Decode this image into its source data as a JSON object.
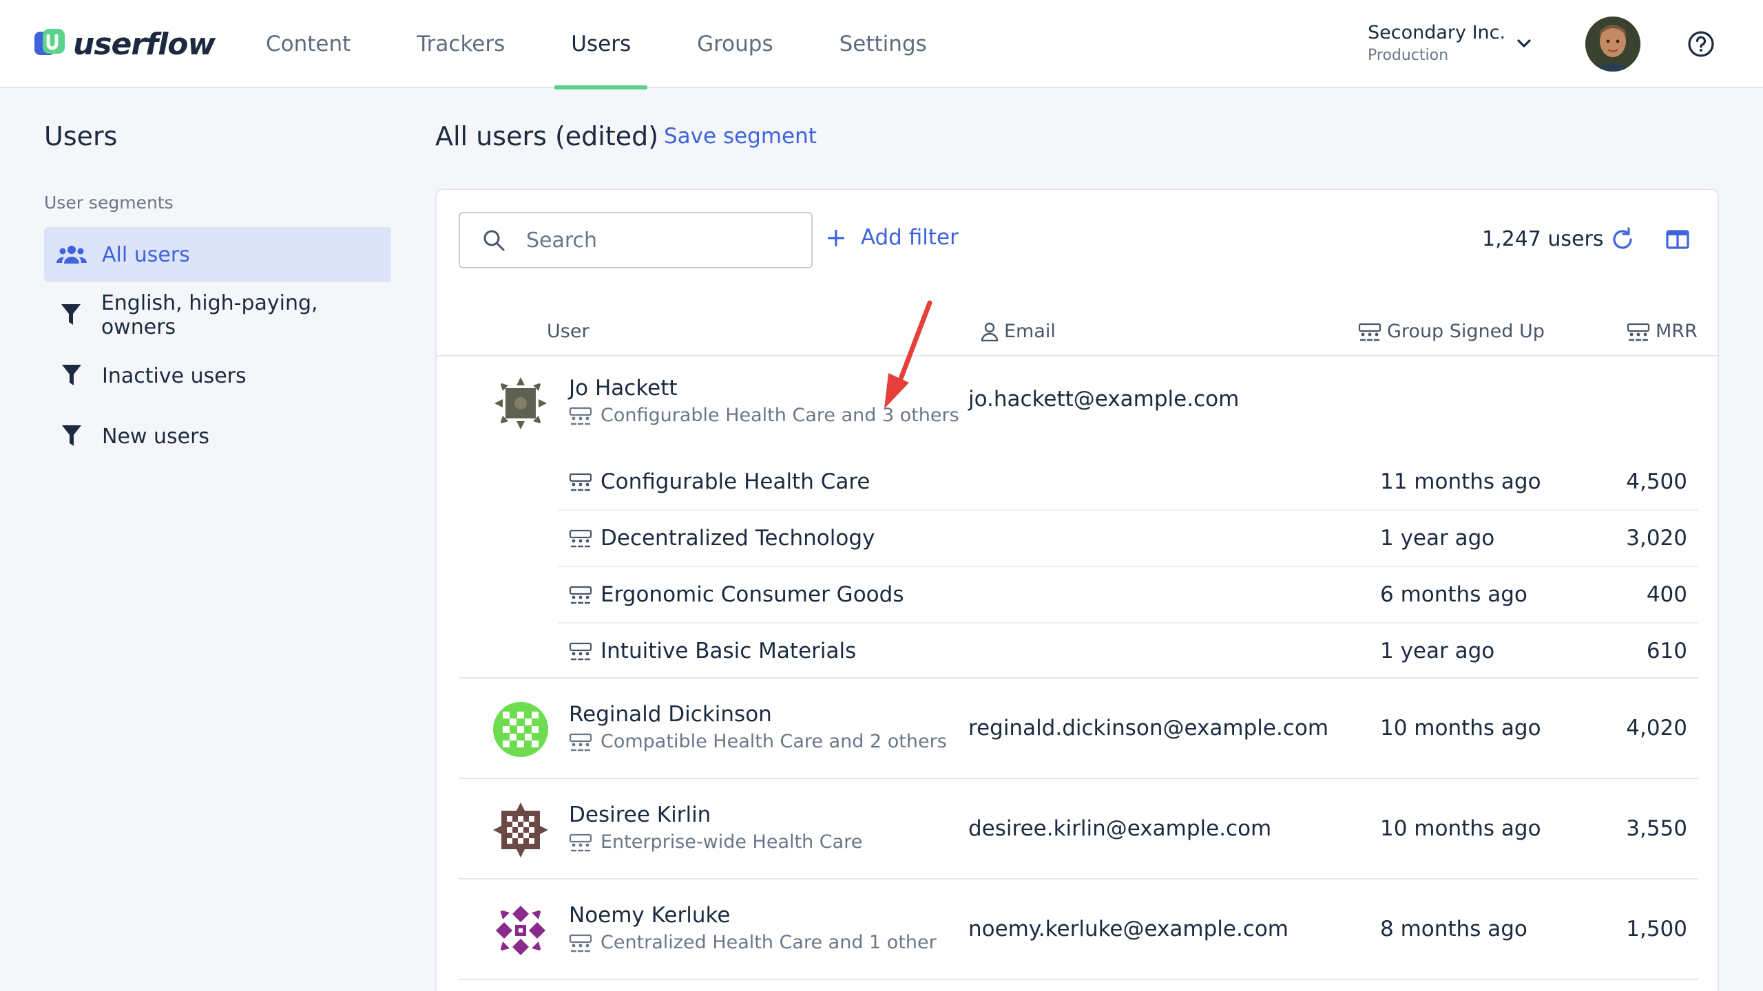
{
  "app": {
    "brand": "userflow"
  },
  "nav": {
    "items": [
      "Content",
      "Trackers",
      "Users",
      "Groups",
      "Settings"
    ],
    "active": "Users"
  },
  "account": {
    "name": "Secondary Inc.",
    "environment": "Production"
  },
  "sidebar": {
    "title": "Users",
    "subtitle": "User segments",
    "segments": [
      {
        "label": "All users",
        "icon": "users-icon",
        "active": true
      },
      {
        "label": "English, high-paying, owners",
        "icon": "filter-icon"
      },
      {
        "label": "Inactive users",
        "icon": "filter-icon"
      },
      {
        "label": "New users",
        "icon": "filter-icon"
      }
    ]
  },
  "main": {
    "title": "All users (edited)",
    "save_segment": "Save segment",
    "search_placeholder": "Search",
    "add_filter": "Add filter",
    "user_count": "1,247 users",
    "columns": {
      "user": "User",
      "email": "Email",
      "group_signed_up": "Group Signed Up",
      "mrr": "MRR"
    }
  },
  "users": [
    {
      "name": "Jo Hackett",
      "group_summary": "Configurable Health Care and 3 others",
      "email": "jo.hackett@example.com",
      "groups": [
        {
          "name": "Configurable Health Care",
          "signed_up": "11 months ago",
          "mrr": "4,500"
        },
        {
          "name": "Decentralized Technology",
          "signed_up": "1 year ago",
          "mrr": "3,020"
        },
        {
          "name": "Ergonomic Consumer Goods",
          "signed_up": "6 months ago",
          "mrr": "400"
        },
        {
          "name": "Intuitive Basic Materials",
          "signed_up": "1 year ago",
          "mrr": "610"
        }
      ]
    },
    {
      "name": "Reginald Dickinson",
      "group_summary": "Compatible Health Care and 2 others",
      "email": "reginald.dickinson@example.com",
      "signed_up": "10 months ago",
      "mrr": "4,020"
    },
    {
      "name": "Desiree Kirlin",
      "group_summary": "Enterprise-wide Health Care",
      "email": "desiree.kirlin@example.com",
      "signed_up": "10 months ago",
      "mrr": "3,550"
    },
    {
      "name": "Noemy Kerluke",
      "group_summary": "Centralized Health Care and 1 other",
      "email": "noemy.kerluke@example.com",
      "signed_up": "8 months ago",
      "mrr": "1,500"
    }
  ],
  "colors": {
    "accent": "#3e63dd",
    "nav_active": "#5ad28a",
    "annotation_arrow": "#e5413a"
  }
}
